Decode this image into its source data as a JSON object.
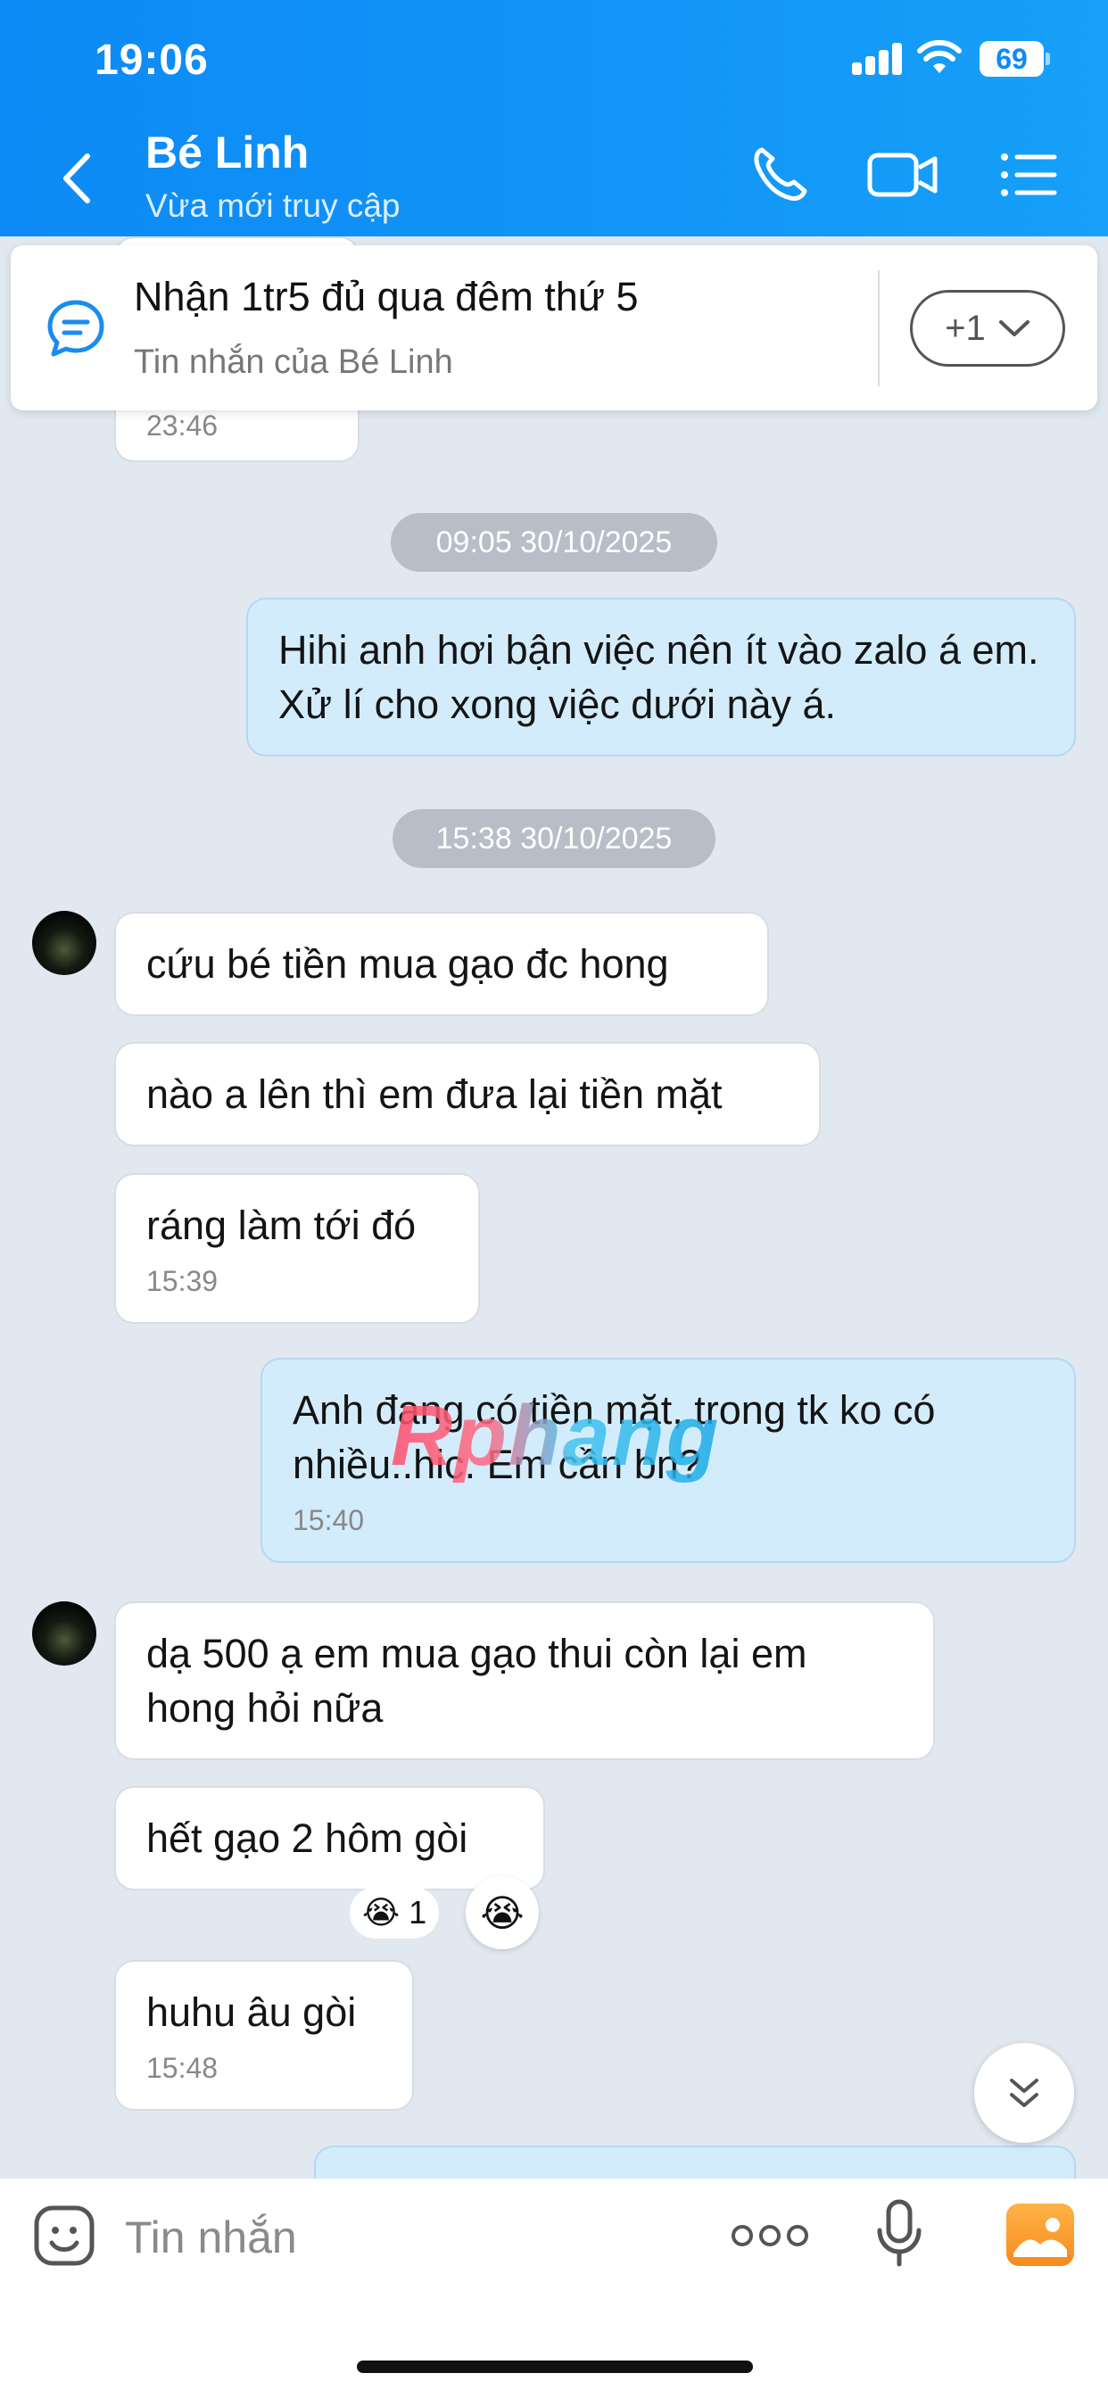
{
  "status_bar": {
    "time": "19:06",
    "battery": "69"
  },
  "header": {
    "contact_name": "Bé Linh",
    "contact_status": "Vừa mới truy cập"
  },
  "pinned": {
    "text": "Nhận 1tr5 đủ qua đêm thứ 5",
    "subtext": "Tin nhắn của Bé Linh",
    "more_label": "+1"
  },
  "messages": {
    "partial_top_time": "23:46",
    "date_1": "09:05 30/10/2025",
    "out_1": "Hihi anh hơi bận việc nên ít vào zalo á em. Xử lí cho xong việc dưới này á.",
    "date_2": "15:38 30/10/2025",
    "in_1": "cứu bé tiền mua gạo đc hong",
    "in_2": "nào a lên thì em đưa lại tiền mặt",
    "in_3": "ráng làm tới đó",
    "in_3_time": "15:39",
    "out_2": "Anh đang có tiền mặt, trong tk ko có nhiều..hic. Em cần bn?",
    "out_2_time": "15:40",
    "in_4": "dạ 500 ạ em mua gạo thui còn lại em hong hỏi nữa",
    "in_5": "hết gạo 2 hôm gòi",
    "in_5_reaction_emoji": "😭",
    "in_5_reaction_count": "1",
    "in_6": "huhu âu gòi",
    "in_6_time": "15:48"
  },
  "watermark": "Rphang",
  "input": {
    "placeholder": "Tin nhắn"
  },
  "colors": {
    "header_blue": "#0d8af5",
    "outgoing_bubble": "#d3ecfc",
    "chat_bg": "#e2e8f0"
  }
}
